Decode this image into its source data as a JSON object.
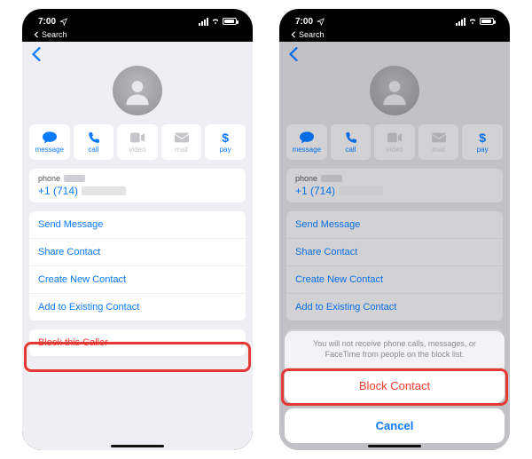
{
  "status": {
    "time": "7:00",
    "back_link": "Search"
  },
  "actions": {
    "message": "message",
    "call": "call",
    "video": "video",
    "mail": "mail",
    "pay": "pay"
  },
  "phone_card": {
    "label": "phone",
    "number_prefix": "+1 (714)"
  },
  "list": {
    "send_message": "Send Message",
    "share_contact": "Share Contact",
    "create_new_contact": "Create New Contact",
    "add_to_existing": "Add to Existing Contact"
  },
  "block_row": "Block this Caller",
  "sheet": {
    "message": "You will not receive phone calls, messages, or FaceTime from people on the block list.",
    "block": "Block Contact",
    "cancel": "Cancel"
  },
  "icons": {
    "pay": "$"
  }
}
